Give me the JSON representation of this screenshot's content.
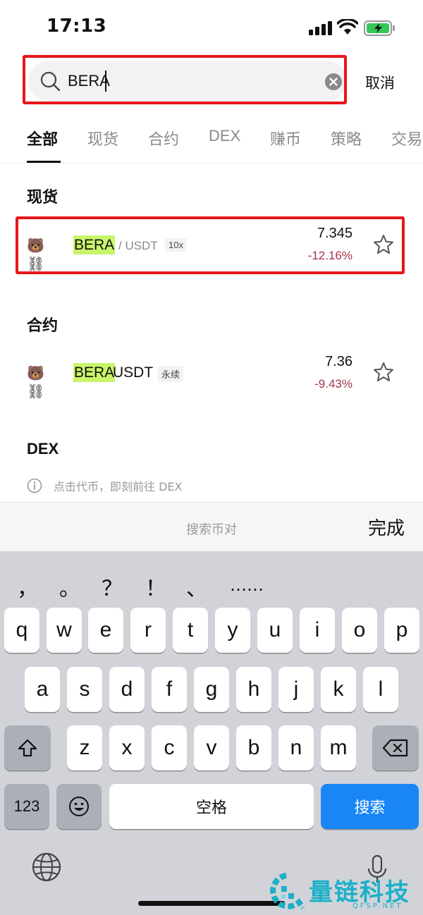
{
  "status_bar": {
    "time": "17:13"
  },
  "search": {
    "value": "BERA",
    "cancel_label": "取消"
  },
  "tabs": [
    {
      "label": "全部",
      "active": true
    },
    {
      "label": "现货",
      "active": false
    },
    {
      "label": "合约",
      "active": false
    },
    {
      "label": "DEX",
      "active": false
    },
    {
      "label": "赚币",
      "active": false
    },
    {
      "label": "策略",
      "active": false
    },
    {
      "label": "交易",
      "active": false
    }
  ],
  "spot": {
    "title": "现货",
    "item": {
      "icon": "🐻⛓",
      "symbol": "BERA",
      "quote": "/ USDT",
      "badge": "10x",
      "price": "7.345",
      "change": "-12.16%"
    }
  },
  "futures": {
    "title": "合约",
    "item": {
      "icon": "🐻⛓",
      "symbol": "BERA",
      "symbol_rest": "USDT",
      "badge": "永续",
      "price": "7.36",
      "change": "-9.43%"
    }
  },
  "dex": {
    "title": "DEX",
    "info": "点击代币，即刻前往 DEX"
  },
  "keyboard": {
    "toolbar_placeholder": "搜索币对",
    "done_label": "完成",
    "punctuation": [
      "，",
      "。",
      "？",
      "！",
      "、",
      "……"
    ],
    "row1": [
      "q",
      "w",
      "e",
      "r",
      "t",
      "y",
      "u",
      "i",
      "o",
      "p"
    ],
    "row2": [
      "a",
      "s",
      "d",
      "f",
      "g",
      "h",
      "j",
      "k",
      "l"
    ],
    "row3": [
      "z",
      "x",
      "c",
      "v",
      "b",
      "n",
      "m"
    ],
    "numbers_label": "123",
    "space_label": "空格",
    "search_label": "搜索"
  },
  "watermark": {
    "text": "量链科技",
    "sub": "QFSP.NET"
  },
  "colors": {
    "highlight": "#c8f56a",
    "negative": "#a4344a",
    "accent": "#1a86f6",
    "annotation": "#e8161a"
  }
}
